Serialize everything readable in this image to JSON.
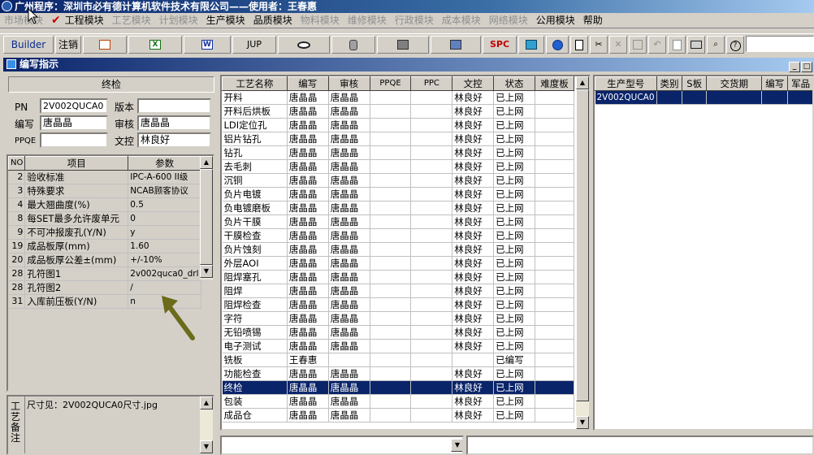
{
  "app": {
    "title": "广州程序：深圳市必有德计算机软件技术有限公司——使用者：王春惠"
  },
  "menu": [
    {
      "label": "市场模块",
      "enabled": false
    },
    {
      "label": "工程模块",
      "enabled": true,
      "checked": true
    },
    {
      "label": "工艺模块",
      "enabled": false
    },
    {
      "label": "计划模块",
      "enabled": false
    },
    {
      "label": "生产模块",
      "enabled": true
    },
    {
      "label": "品质模块",
      "enabled": true
    },
    {
      "label": "物料模块",
      "enabled": false
    },
    {
      "label": "维修模块",
      "enabled": false
    },
    {
      "label": "行政模块",
      "enabled": false
    },
    {
      "label": "成本模块",
      "enabled": false
    },
    {
      "label": "网络模块",
      "enabled": false
    },
    {
      "label": "公用模块",
      "enabled": true
    },
    {
      "label": "帮助",
      "enabled": true
    }
  ],
  "toolbar": {
    "builder": "Builder",
    "logout": "注销",
    "jup": "JUP",
    "spc": "SPC",
    "icons": [
      "powerpoint-icon",
      "excel-icon",
      "word-icon",
      "eye-icon",
      "database-icon",
      "network-icon",
      "monitor-icon",
      "spc-icon",
      "package-icon",
      "globe-icon",
      "new-document-icon",
      "cut-icon",
      "delete-icon",
      "save-icon",
      "undo-icon",
      "preview-icon",
      "print-icon",
      "find-icon",
      "help-icon"
    ]
  },
  "window": {
    "title": "编写指示"
  },
  "left": {
    "section_title": "终检",
    "pn_label": "PN",
    "pn_value": "2V002QUCA0",
    "version_label": "版本",
    "version_value": "",
    "author_label": "编写",
    "author_value": "唐晶晶",
    "review_label": "审核",
    "review_value": "唐晶晶",
    "ppqe_label": "PPQE",
    "ppqe_value": "",
    "doc_label": "文控",
    "doc_value": "林良好",
    "params_headers": [
      "NO",
      "项目",
      "参数"
    ],
    "params": [
      {
        "no": "2",
        "item": "验收标准",
        "value": "IPC-A-600 II级"
      },
      {
        "no": "3",
        "item": "特殊要求",
        "value": "NCAB顾客协议"
      },
      {
        "no": "4",
        "item": "最大翘曲度(%)",
        "value": "0.5"
      },
      {
        "no": "8",
        "item": "每SET最多允许废单元",
        "value": "0"
      },
      {
        "no": "9",
        "item": "不可冲报废孔(Y/N)",
        "value": "y"
      },
      {
        "no": "19",
        "item": "成品板厚(mm)",
        "value": "1.60"
      },
      {
        "no": "20",
        "item": "成品板厚公差±(mm)",
        "value": "+/-10%"
      },
      {
        "no": "28",
        "item": "孔符图1",
        "value": "2v002quca0_drl"
      },
      {
        "no": "28",
        "item": "孔符图2",
        "value": "/"
      },
      {
        "no": "31",
        "item": "入库前压板(Y/N)",
        "value": "n"
      }
    ],
    "remark_label": "工艺备注",
    "remark_text": "尺寸见：2V002QUCA0尺寸.jpg"
  },
  "processes": {
    "headers": [
      "工艺名称",
      "编写",
      "审核",
      "PPQE",
      "PPC",
      "文控",
      "状态",
      "难度板"
    ],
    "rows": [
      {
        "name": "开料",
        "author": "唐晶晶",
        "review": "唐晶晶",
        "ppqe": "",
        "ppc": "",
        "doc": "林良好",
        "status": "已上网",
        "diff": ""
      },
      {
        "name": "开料后烘板",
        "author": "唐晶晶",
        "review": "唐晶晶",
        "ppqe": "",
        "ppc": "",
        "doc": "林良好",
        "status": "已上网",
        "diff": ""
      },
      {
        "name": "LDI定位孔",
        "author": "唐晶晶",
        "review": "唐晶晶",
        "ppqe": "",
        "ppc": "",
        "doc": "林良好",
        "status": "已上网",
        "diff": ""
      },
      {
        "name": "铝片钻孔",
        "author": "唐晶晶",
        "review": "唐晶晶",
        "ppqe": "",
        "ppc": "",
        "doc": "林良好",
        "status": "已上网",
        "diff": ""
      },
      {
        "name": "钻孔",
        "author": "唐晶晶",
        "review": "唐晶晶",
        "ppqe": "",
        "ppc": "",
        "doc": "林良好",
        "status": "已上网",
        "diff": ""
      },
      {
        "name": "去毛刺",
        "author": "唐晶晶",
        "review": "唐晶晶",
        "ppqe": "",
        "ppc": "",
        "doc": "林良好",
        "status": "已上网",
        "diff": ""
      },
      {
        "name": "沉铜",
        "author": "唐晶晶",
        "review": "唐晶晶",
        "ppqe": "",
        "ppc": "",
        "doc": "林良好",
        "status": "已上网",
        "diff": ""
      },
      {
        "name": "负片电镀",
        "author": "唐晶晶",
        "review": "唐晶晶",
        "ppqe": "",
        "ppc": "",
        "doc": "林良好",
        "status": "已上网",
        "diff": ""
      },
      {
        "name": "负电镀磨板",
        "author": "唐晶晶",
        "review": "唐晶晶",
        "ppqe": "",
        "ppc": "",
        "doc": "林良好",
        "status": "已上网",
        "diff": ""
      },
      {
        "name": "负片干膜",
        "author": "唐晶晶",
        "review": "唐晶晶",
        "ppqe": "",
        "ppc": "",
        "doc": "林良好",
        "status": "已上网",
        "diff": ""
      },
      {
        "name": "干膜检查",
        "author": "唐晶晶",
        "review": "唐晶晶",
        "ppqe": "",
        "ppc": "",
        "doc": "林良好",
        "status": "已上网",
        "diff": ""
      },
      {
        "name": "负片蚀刻",
        "author": "唐晶晶",
        "review": "唐晶晶",
        "ppqe": "",
        "ppc": "",
        "doc": "林良好",
        "status": "已上网",
        "diff": ""
      },
      {
        "name": "外层AOI",
        "author": "唐晶晶",
        "review": "唐晶晶",
        "ppqe": "",
        "ppc": "",
        "doc": "林良好",
        "status": "已上网",
        "diff": ""
      },
      {
        "name": "阻焊塞孔",
        "author": "唐晶晶",
        "review": "唐晶晶",
        "ppqe": "",
        "ppc": "",
        "doc": "林良好",
        "status": "已上网",
        "diff": ""
      },
      {
        "name": "阻焊",
        "author": "唐晶晶",
        "review": "唐晶晶",
        "ppqe": "",
        "ppc": "",
        "doc": "林良好",
        "status": "已上网",
        "diff": ""
      },
      {
        "name": "阻焊检查",
        "author": "唐晶晶",
        "review": "唐晶晶",
        "ppqe": "",
        "ppc": "",
        "doc": "林良好",
        "status": "已上网",
        "diff": ""
      },
      {
        "name": "字符",
        "author": "唐晶晶",
        "review": "唐晶晶",
        "ppqe": "",
        "ppc": "",
        "doc": "林良好",
        "status": "已上网",
        "diff": ""
      },
      {
        "name": "无铅喷锡",
        "author": "唐晶晶",
        "review": "唐晶晶",
        "ppqe": "",
        "ppc": "",
        "doc": "林良好",
        "status": "已上网",
        "diff": ""
      },
      {
        "name": "电子测试",
        "author": "唐晶晶",
        "review": "唐晶晶",
        "ppqe": "",
        "ppc": "",
        "doc": "林良好",
        "status": "已上网",
        "diff": ""
      },
      {
        "name": "铣板",
        "author": "王春惠",
        "review": "",
        "ppqe": "",
        "ppc": "",
        "doc": "",
        "status": "已编写",
        "diff": ""
      },
      {
        "name": "功能检查",
        "author": "唐晶晶",
        "review": "唐晶晶",
        "ppqe": "",
        "ppc": "",
        "doc": "林良好",
        "status": "已上网",
        "diff": ""
      },
      {
        "name": "终检",
        "author": "唐晶晶",
        "review": "唐晶晶",
        "ppqe": "",
        "ppc": "",
        "doc": "林良好",
        "status": "已上网",
        "diff": "",
        "selected": true
      },
      {
        "name": "包装",
        "author": "唐晶晶",
        "review": "唐晶晶",
        "ppqe": "",
        "ppc": "",
        "doc": "林良好",
        "status": "已上网",
        "diff": ""
      },
      {
        "name": "成品仓",
        "author": "唐晶晶",
        "review": "唐晶晶",
        "ppqe": "",
        "ppc": "",
        "doc": "林良好",
        "status": "已上网",
        "diff": ""
      }
    ]
  },
  "products": {
    "headers": [
      "生产型号",
      "类别",
      "S板",
      "交货期",
      "编写",
      "军品"
    ],
    "rows": [
      {
        "model": "2V002QUCA0",
        "type": "",
        "sboard": "",
        "delivery": "",
        "author": "",
        "military": "",
        "selected": true
      }
    ]
  },
  "colors": {
    "selection": "#0a246a",
    "face": "#d4d0c8",
    "arrow": "#6b6b1a"
  }
}
